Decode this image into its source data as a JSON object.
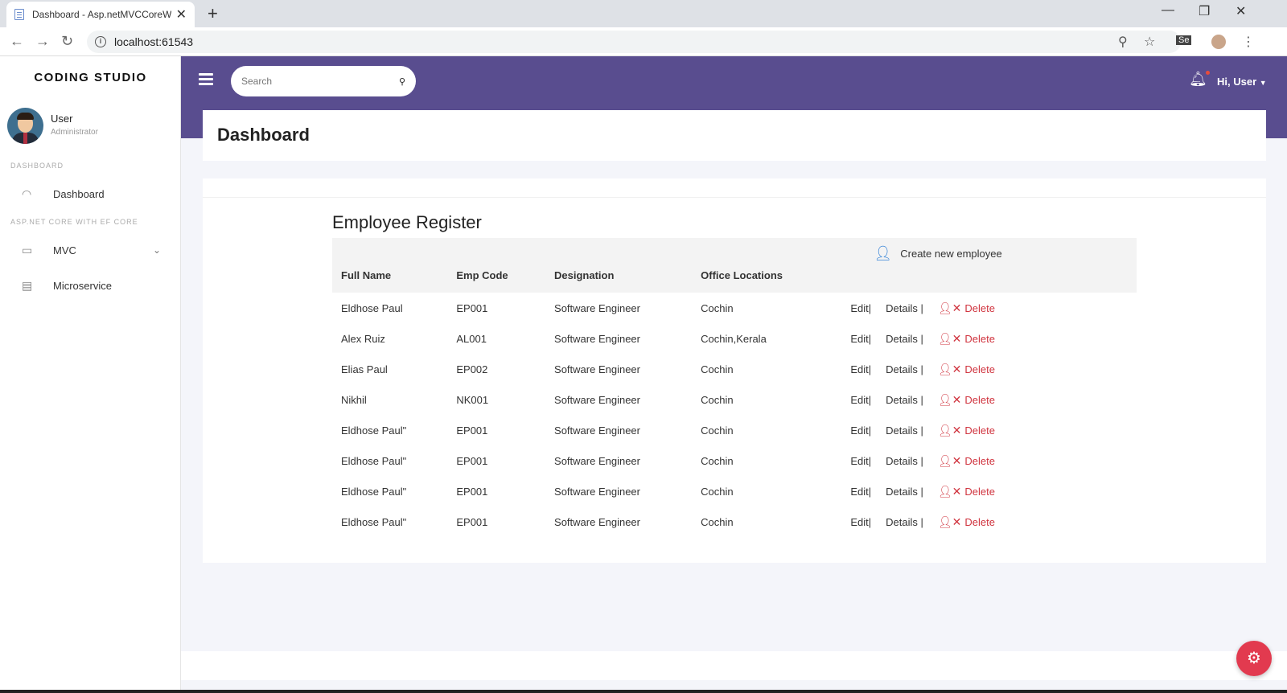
{
  "browser": {
    "tab_title": "Dashboard - Asp.netMVCCoreWi",
    "url": "localhost:61543"
  },
  "sidebar": {
    "brand": "CODING STUDIO",
    "user_name": "User",
    "user_role": "Administrator",
    "section_dashboard": "DASHBOARD",
    "section_aspnet": "ASP.NET CORE WITH EF CORE",
    "items": [
      {
        "label": "Dashboard",
        "icon": "gauge-icon"
      },
      {
        "label": "MVC",
        "icon": "window-icon"
      },
      {
        "label": "Microservice",
        "icon": "clipboard-icon"
      }
    ]
  },
  "header": {
    "search_placeholder": "Search",
    "greeting": "Hi, User"
  },
  "page": {
    "title": "Dashboard"
  },
  "register": {
    "title": "Employee Register",
    "columns": [
      "Full Name",
      "Emp Code",
      "Designation",
      "Office Locations"
    ],
    "create_label": "Create new employee",
    "action_edit": "Edit|",
    "action_details": "Details |",
    "action_delete": "Delete",
    "rows": [
      {
        "name": "Eldhose Paul",
        "code": "EP001",
        "designation": "Software Engineer",
        "location": "Cochin"
      },
      {
        "name": "Alex Ruiz",
        "code": "AL001",
        "designation": "Software Engineer",
        "location": "Cochin,Kerala"
      },
      {
        "name": "Elias Paul",
        "code": "EP002",
        "designation": "Software Engineer",
        "location": "Cochin"
      },
      {
        "name": "Nikhil",
        "code": "NK001",
        "designation": "Software Engineer",
        "location": "Cochin"
      },
      {
        "name": "Eldhose Paul\"",
        "code": "EP001",
        "designation": "Software Engineer",
        "location": "Cochin"
      },
      {
        "name": "Eldhose Paul\"",
        "code": "EP001",
        "designation": "Software Engineer",
        "location": "Cochin"
      },
      {
        "name": "Eldhose Paul\"",
        "code": "EP001",
        "designation": "Software Engineer",
        "location": "Cochin"
      },
      {
        "name": "Eldhose Paul\"",
        "code": "EP001",
        "designation": "Software Engineer",
        "location": "Cochin"
      }
    ]
  },
  "colors": {
    "header_bg": "#594d8f",
    "delete": "#d0343f",
    "create_icon": "#3a86d8",
    "fab": "#e23a4f"
  }
}
